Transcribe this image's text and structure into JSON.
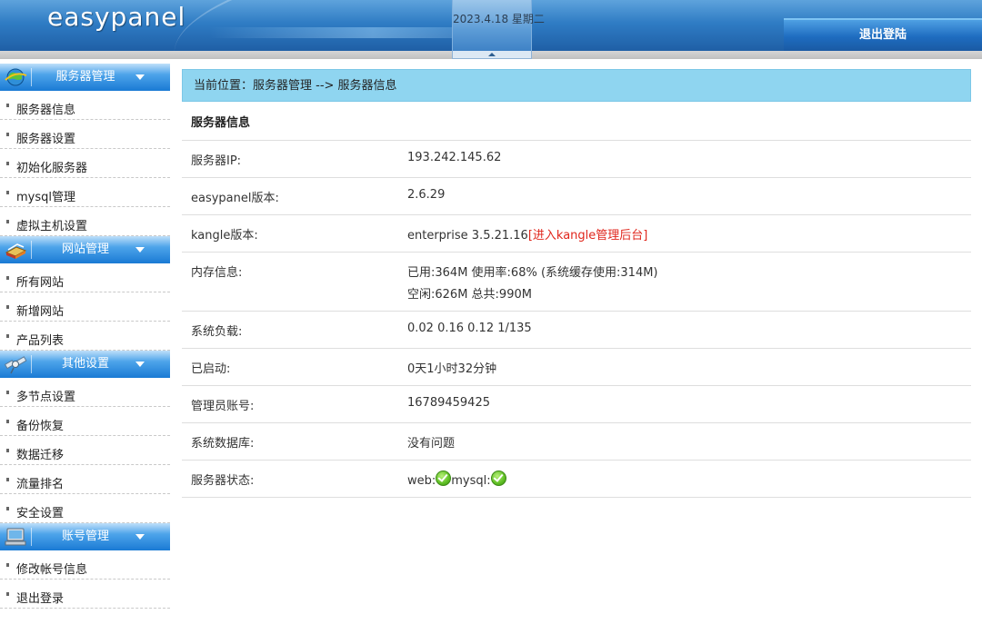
{
  "header": {
    "logo_text": "easypanel",
    "date": "2023.4.18 星期二",
    "logout_label": "退出登陆"
  },
  "sidebar": {
    "groups": [
      {
        "title": "服务器管理",
        "icon": "server-globe-icon",
        "items": [
          {
            "label": "服务器信息"
          },
          {
            "label": "服务器设置"
          },
          {
            "label": "初始化服务器"
          },
          {
            "label": "mysql管理"
          },
          {
            "label": "虚拟主机设置"
          }
        ]
      },
      {
        "title": "网站管理",
        "icon": "books-icon",
        "items": [
          {
            "label": "所有网站"
          },
          {
            "label": "新增网站"
          },
          {
            "label": "产品列表"
          }
        ]
      },
      {
        "title": "其他设置",
        "icon": "satellite-icon",
        "items": [
          {
            "label": "多节点设置"
          },
          {
            "label": "备份恢复"
          },
          {
            "label": "数据迁移"
          },
          {
            "label": "流量排名"
          },
          {
            "label": "安全设置"
          }
        ]
      },
      {
        "title": "账号管理",
        "icon": "computer-icon",
        "items": [
          {
            "label": "修改帐号信息"
          },
          {
            "label": "退出登录"
          }
        ]
      }
    ]
  },
  "main": {
    "breadcrumb": "当前位置：服务器管理 --> 服务器信息",
    "table_title": "服务器信息",
    "rows": {
      "ip": {
        "label": "服务器IP:",
        "value": "193.242.145.62"
      },
      "version": {
        "label": "easypanel版本:",
        "value": "2.6.29"
      },
      "kangle": {
        "label": "kangle版本:",
        "value": "enterprise 3.5.21.16",
        "link_open": "[",
        "link": "进入kangle管理后台",
        "link_close": "]"
      },
      "memory": {
        "label": "内存信息:",
        "line1": "已用:364M 使用率:68% (系统缓存使用:314M)",
        "line2": "空闲:626M 总共:990M"
      },
      "load": {
        "label": "系统负载:",
        "value": "0.02 0.16 0.12 1/135"
      },
      "uptime": {
        "label": "已启动:",
        "value": "0天1小时32分钟"
      },
      "admin": {
        "label": "管理员账号:",
        "value": "16789459425"
      },
      "database": {
        "label": "系统数据库:",
        "value": "没有问题"
      },
      "status": {
        "label": "服务器状态:",
        "web": "web:",
        "mysql": "mysql:"
      }
    }
  },
  "colors": {
    "header_blue": "#2f7cc4",
    "breadcrumb_bg": "#8fd5f0",
    "link_red": "#e0261c",
    "ok_green": "#1d9d2a"
  }
}
